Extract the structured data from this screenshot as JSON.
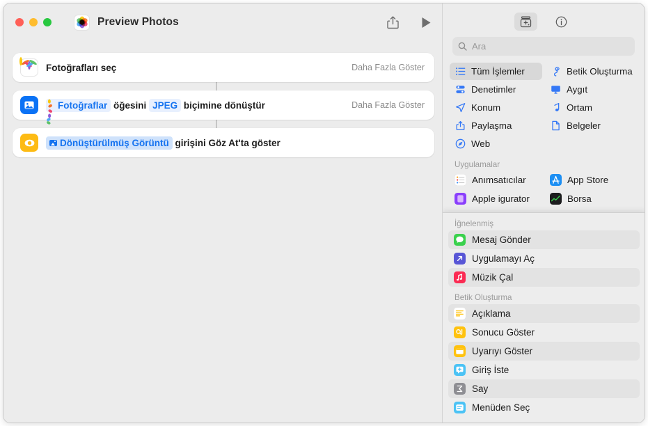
{
  "window": {
    "title": "Preview Photos",
    "app_icon": "photos-icon",
    "traffic_lights": [
      "close",
      "minimize",
      "zoom"
    ],
    "toolbar": [
      {
        "name": "share-button",
        "icon": "share-icon"
      },
      {
        "name": "run-button",
        "icon": "play-icon"
      }
    ]
  },
  "workflow": {
    "actions": [
      {
        "icon": "photos-app-icon",
        "icon_style": "photos",
        "segments": [
          {
            "type": "text",
            "text": "Fotoğrafları seç"
          }
        ],
        "show_more": "Daha Fazla Göster"
      },
      {
        "icon": "convert-image-icon",
        "icon_style": "blue",
        "segments": [
          {
            "type": "var-photos",
            "text": "Fotoğraflar"
          },
          {
            "type": "text",
            "text": "öğesini"
          },
          {
            "type": "var-jpeg",
            "text": "JPEG"
          },
          {
            "type": "text",
            "text": "biçimine dönüştür"
          }
        ],
        "show_more": "Daha Fazla Göster"
      },
      {
        "icon": "quick-look-icon",
        "icon_style": "amber",
        "segments": [
          {
            "type": "var-conv",
            "text": "Dönüştürülmüş Görüntü"
          },
          {
            "type": "text",
            "text": "girişini Göz At'ta göster"
          }
        ],
        "show_more": ""
      }
    ]
  },
  "library": {
    "toolbar": [
      {
        "name": "action-library-button",
        "icon": "library-icon",
        "active": true
      },
      {
        "name": "info-button",
        "icon": "info-circle-icon",
        "active": false
      }
    ],
    "search": {
      "placeholder": "Ara",
      "value": ""
    },
    "categories": [
      {
        "label": "Tüm İşlemler",
        "icon": "list-icon",
        "selected": true
      },
      {
        "label": "Betik Oluşturma",
        "icon": "scripting-icon",
        "selected": false
      },
      {
        "label": "Denetimler",
        "icon": "controls-icon",
        "selected": false
      },
      {
        "label": "Aygıt",
        "icon": "device-icon",
        "selected": false
      },
      {
        "label": "Konum",
        "icon": "location-icon",
        "selected": false
      },
      {
        "label": "Ortam",
        "icon": "media-note-icon",
        "selected": false
      },
      {
        "label": "Paylaşma",
        "icon": "share-icon",
        "selected": false
      },
      {
        "label": "Belgeler",
        "icon": "document-icon",
        "selected": false
      },
      {
        "label": "Web",
        "icon": "safari-compass-icon",
        "selected": false
      }
    ],
    "apps_header": "Uygulamalar",
    "apps": [
      {
        "label": "Anımsatıcılar",
        "icon": "reminders-icon",
        "color": "#ffffff"
      },
      {
        "label": "App Store",
        "icon": "app-store-icon",
        "color": "#1d8ff3"
      },
      {
        "label": "Apple  igurator",
        "icon": "apple-configurator-icon",
        "color": "#8a3ffc"
      },
      {
        "label": "Borsa",
        "icon": "stocks-icon",
        "color": "#1c1c1e"
      }
    ]
  },
  "overlay": {
    "pinned_header": "İğnelenmiş",
    "pinned": [
      {
        "label": "Mesaj Gönder",
        "icon": "messages-icon",
        "color": "#3ad14d",
        "alt": true
      },
      {
        "label": "Uygulamayı Aç",
        "icon": "open-app-icon",
        "color": "#5856d6",
        "alt": false
      },
      {
        "label": "Müzik Çal",
        "icon": "music-icon",
        "color": "#fb2b53",
        "alt": true
      }
    ],
    "scripting_header": "Betik Oluşturma",
    "scripting": [
      {
        "label": "Açıklama",
        "icon": "comment-icon",
        "color": "#ffffff",
        "alt": true
      },
      {
        "label": "Sonucu Göster",
        "icon": "show-result-icon",
        "color": "#ffc20e",
        "alt": false
      },
      {
        "label": "Uyarıyı Göster",
        "icon": "show-alert-icon",
        "color": "#ffc20e",
        "alt": true
      },
      {
        "label": "Giriş İste",
        "icon": "ask-for-input-icon",
        "color": "#4cc3f5",
        "alt": false
      },
      {
        "label": "Say",
        "icon": "count-icon",
        "color": "#8e8e93",
        "alt": true
      },
      {
        "label": "Menüden Seç",
        "icon": "choose-from-menu-icon",
        "color": "#4cc3f5",
        "alt": false
      }
    ]
  },
  "colors": {
    "accent_blue": "#3478f6",
    "token_blue": "#1573f0",
    "window_bg": "#ececec",
    "card_bg": "#ffffff"
  }
}
